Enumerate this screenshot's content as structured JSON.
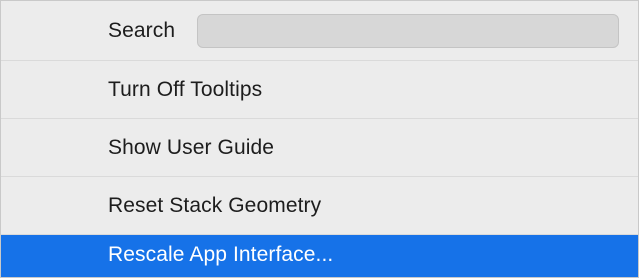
{
  "menu": {
    "search": {
      "label": "Search",
      "value": "",
      "placeholder": ""
    },
    "items": [
      {
        "label": "Turn Off Tooltips"
      },
      {
        "label": "Show User Guide"
      },
      {
        "label": "Reset Stack Geometry"
      },
      {
        "label": "Rescale App Interface...",
        "highlighted": true
      }
    ]
  },
  "colors": {
    "menu_background": "#ececec",
    "highlight": "#1672e8",
    "highlight_text": "#ffffff",
    "text": "#1d1d1d",
    "search_field": "#d7d7d7"
  }
}
